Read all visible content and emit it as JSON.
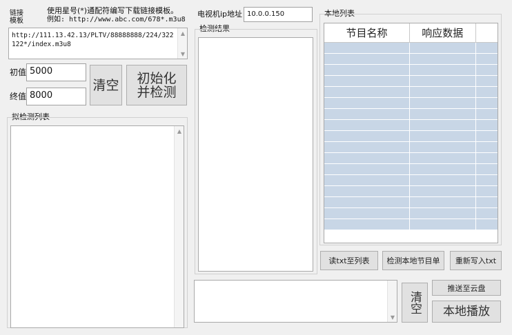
{
  "template": {
    "label": "链接模板",
    "hint_line1": "使用星号(*)通配符编写下载链接模板。",
    "hint_line2": "例如: http://www.abc.com/678*.m3u8",
    "url_value": "http://111.13.42.13/PLTV/88888888/224/322122*/index.m3u8"
  },
  "range": {
    "start_label": "初值",
    "start_value": "5000",
    "end_label": "终值",
    "end_value": "8000",
    "clear_label": "清空",
    "init_label_line1": "初始化",
    "init_label_line2": "并检测"
  },
  "pending_list": {
    "label": "拟检测列表"
  },
  "tv": {
    "ip_label": "电视机ip地址",
    "ip_value": "10.0.0.150"
  },
  "results": {
    "label": "检测结果"
  },
  "local_list": {
    "label": "本地列表",
    "columns": [
      "节目名称",
      "响应数据"
    ],
    "rows": [
      [
        "",
        ""
      ],
      [
        "",
        ""
      ],
      [
        "",
        ""
      ],
      [
        "",
        ""
      ],
      [
        "",
        ""
      ],
      [
        "",
        ""
      ],
      [
        "",
        ""
      ],
      [
        "",
        ""
      ],
      [
        "",
        ""
      ],
      [
        "",
        ""
      ],
      [
        "",
        ""
      ],
      [
        "",
        ""
      ],
      [
        "",
        ""
      ],
      [
        "",
        ""
      ],
      [
        "",
        ""
      ],
      [
        "",
        ""
      ],
      [
        "",
        ""
      ]
    ]
  },
  "actions": {
    "read_txt": "读txt至列表",
    "check_local": "检测本地节目单",
    "rewrite_txt": "重新写入txt",
    "push_cloud": "推送至云盘",
    "clear2": "清空",
    "local_play": "本地播放"
  },
  "colors": {
    "grid_row": "#c8d6e6",
    "window_bg": "#f0f0f0",
    "button_bg": "#e1e1e1"
  }
}
